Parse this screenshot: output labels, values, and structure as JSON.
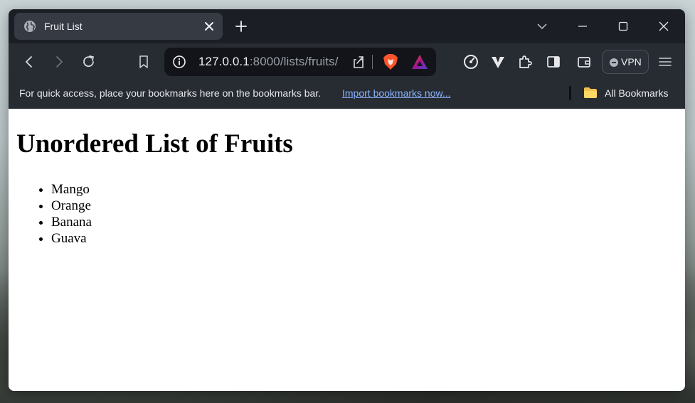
{
  "browser": {
    "tab_title": "Fruit List",
    "url_host": "127.0.0.1",
    "url_rest": ":8000/lists/fruits/",
    "vpn_label": "VPN"
  },
  "bookmarks_bar": {
    "hint": "For quick access, place your bookmarks here on the bookmarks bar.",
    "import_link": "Import bookmarks now...",
    "all_bookmarks": "All Bookmarks"
  },
  "page": {
    "heading": "Unordered List of Fruits",
    "fruits": [
      "Mango",
      "Orange",
      "Banana",
      "Guava"
    ]
  },
  "colors": {
    "tabstrip": "#1b1e24",
    "toolbar": "#272b32",
    "active_tab": "#353a43",
    "link": "#8ab4ff"
  },
  "icons": [
    "globe-icon",
    "close-icon",
    "plus-icon",
    "chevron-down-icon",
    "minimize-icon",
    "maximize-icon",
    "window-close-icon",
    "back-icon",
    "forward-icon",
    "reload-icon",
    "bookmark-icon",
    "info-icon",
    "share-icon",
    "brave-shield-icon",
    "brave-rewards-icon",
    "speedometer-icon",
    "vee-icon",
    "extensions-icon",
    "sidebar-icon",
    "wallet-icon",
    "menu-icon",
    "folder-icon"
  ]
}
